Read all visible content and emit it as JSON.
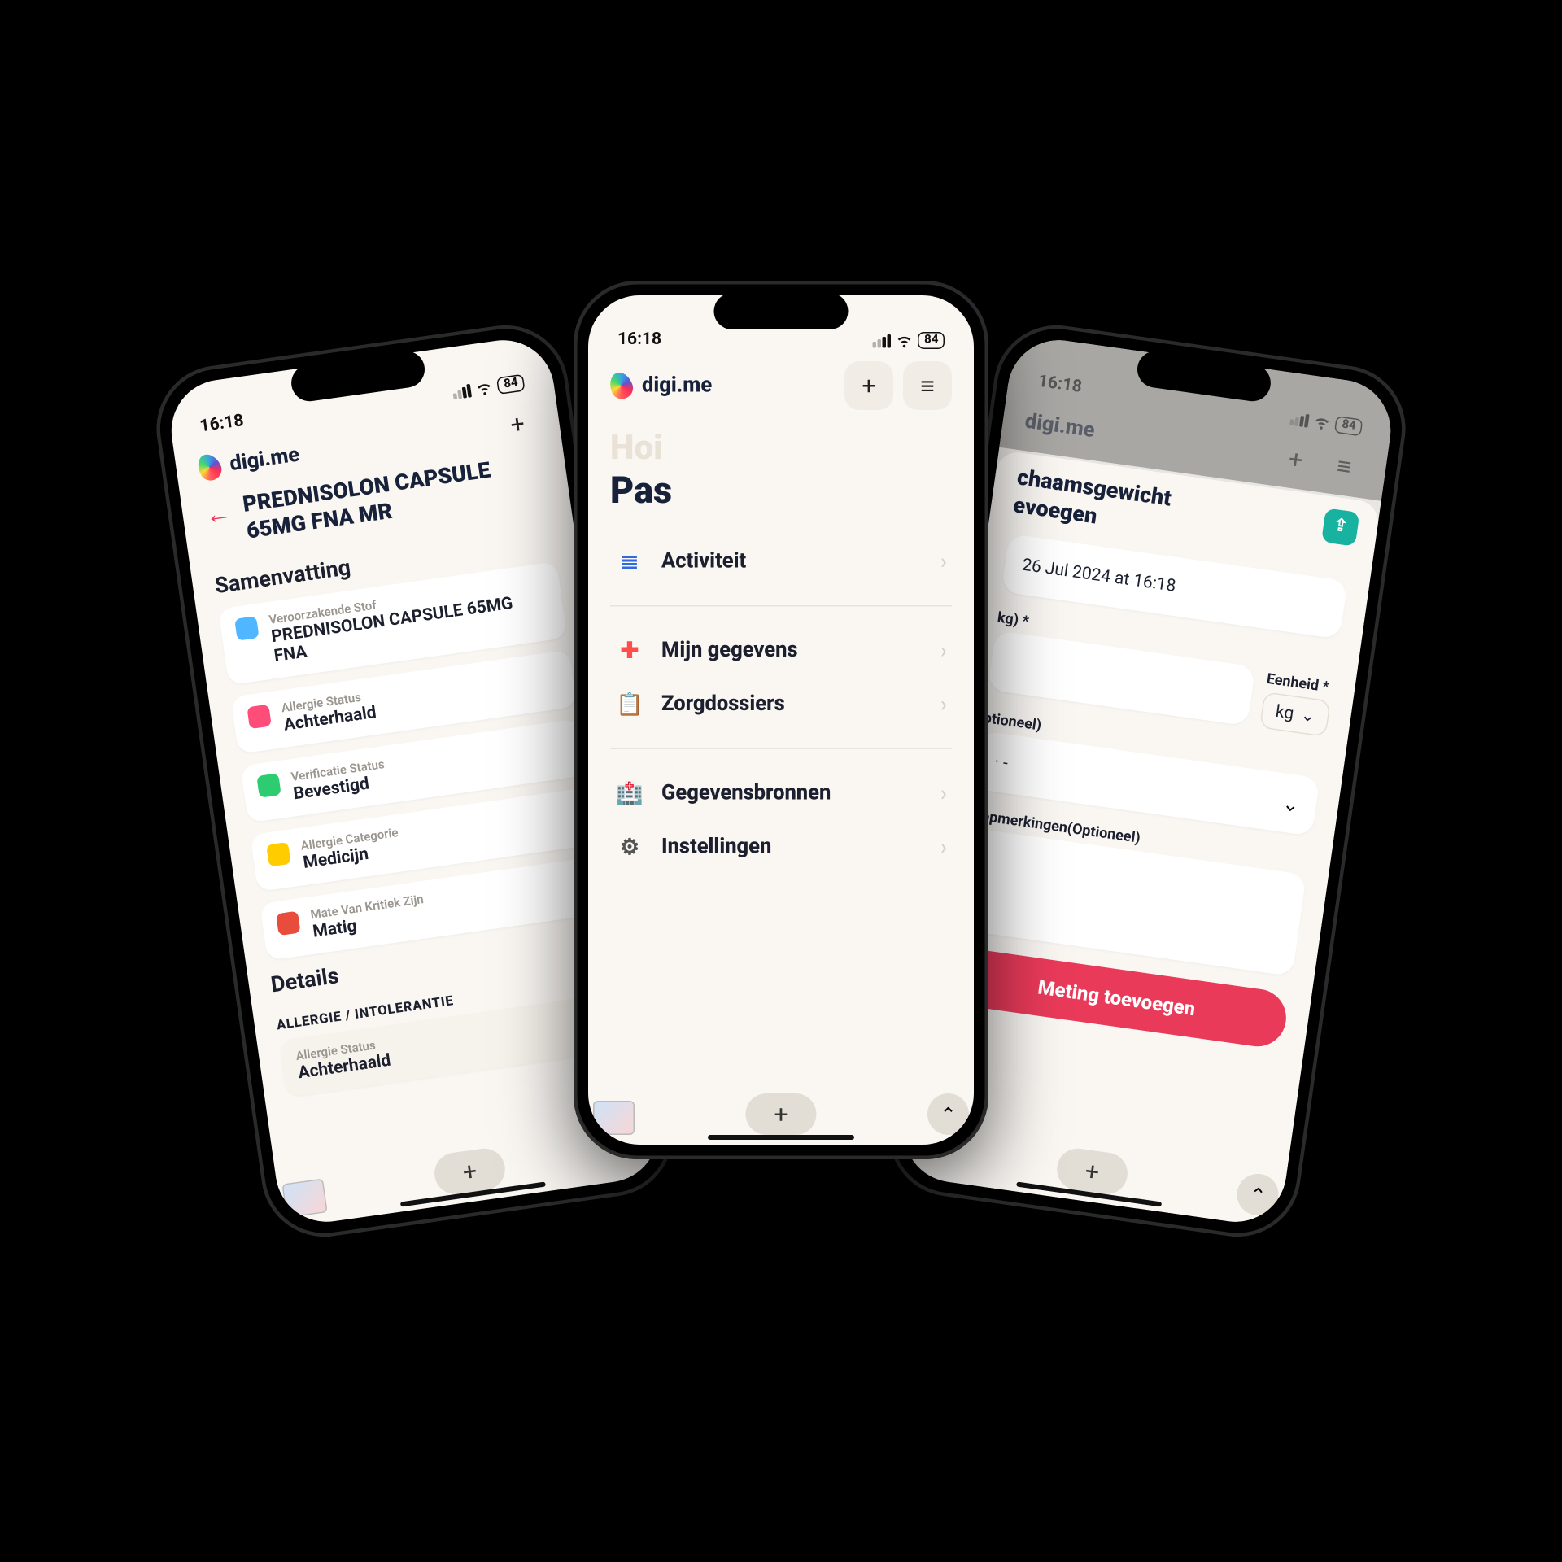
{
  "status": {
    "time": "16:18",
    "battery": "84"
  },
  "brand": "digi.me",
  "center": {
    "hello": "Hoi",
    "name": "Pas",
    "groups": {
      "g1": {
        "activity": "Activiteit"
      },
      "g2": {
        "mydata": "Mijn gegevens",
        "records": "Zorgdossiers"
      },
      "g3": {
        "sources": "Gegevensbronnen",
        "settings": "Instellingen"
      }
    }
  },
  "left": {
    "title": "PREDNISOLON CAPSULE 65MG FNA MR",
    "sections": {
      "summary": "Samenvatting",
      "details": "Details",
      "details_sub": "ALLERGIE / INTOLERANTIE"
    },
    "cards": {
      "substance": {
        "label": "Veroorzakende Stof",
        "value": "PREDNISOLON CAPSULE 65MG FNA"
      },
      "allergy": {
        "label": "Allergie Status",
        "value": "Achterhaald"
      },
      "verify": {
        "label": "Verificatie Status",
        "value": "Bevestigd"
      },
      "category": {
        "label": "Allergie Categorie",
        "value": "Medicijn"
      },
      "critical": {
        "label": "Mate Van Kritiek Zijn",
        "value": "Matig"
      },
      "allergy2": {
        "label": "Allergie Status",
        "value": "Achterhaald"
      }
    }
  },
  "right": {
    "title_l1": "chaamsgewicht",
    "title_l2": "evoegen",
    "date_label": "",
    "date_value": "26 Jul 2024 at 16:18",
    "weight_label": "kg) *",
    "unit_label": "Eenheid *",
    "unit_value": "kg",
    "optional1": "ptioneel)",
    "optional1_placeholder": "· -",
    "remarks_label": "e opmerkingen(Optioneel)",
    "cta": "Meting toevoegen"
  }
}
